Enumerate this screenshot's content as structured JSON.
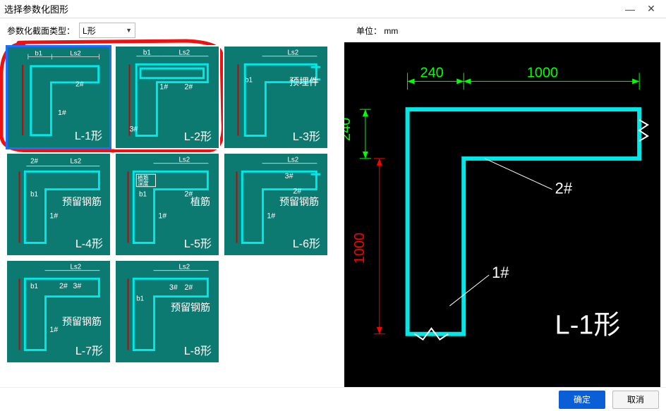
{
  "title": "选择参数化图形",
  "window": {
    "minimize": "—",
    "close": "✕"
  },
  "typeLabel": "参数化截面类型：",
  "typeValue": "L形",
  "unitLabel": "单位：",
  "unitValue": "mm",
  "thumbs": [
    {
      "name": "L-1形",
      "dims": {
        "b1": "b1",
        "ls2": "Ls2",
        "tag1": "1#",
        "tag2": "2#"
      }
    },
    {
      "name": "L-2形",
      "dims": {
        "b1": "b1",
        "ls2": "Ls2",
        "tag1": "1#",
        "tag2": "2#",
        "tag3": "3#"
      }
    },
    {
      "name": "L-3形",
      "dims": {
        "b1": "b1",
        "ls2": "Ls2",
        "extra": "预埋件"
      }
    },
    {
      "name": "L-4形",
      "dims": {
        "b1": "b1",
        "ls2": "Ls2",
        "tag1": "1#",
        "tag2": "2#",
        "extra": "预留钢筋"
      }
    },
    {
      "name": "L-5形",
      "dims": {
        "b1": "b1",
        "ls2": "Ls2",
        "tag1": "1#",
        "tag2": "2#",
        "extra": "植筋",
        "extra2": "植筋\n深度"
      }
    },
    {
      "name": "L-6形",
      "dims": {
        "b1": "b1",
        "ls2": "Ls2",
        "tag1": "1#",
        "tag2": "2#",
        "tag3": "3#",
        "extra": "预留钢筋"
      }
    },
    {
      "name": "L-7形",
      "dims": {
        "b1": "b1",
        "ls2": "Ls2",
        "tag1": "1#",
        "tag2": "2#",
        "tag3": "3#",
        "extra": "预留钢筋"
      }
    },
    {
      "name": "L-8形",
      "dims": {
        "b1": "b1",
        "ls2": "Ls2",
        "tag2": "2#",
        "tag3": "3#",
        "extra": "预留钢筋"
      }
    }
  ],
  "preview": {
    "name": "L-1形",
    "dimA": "240",
    "dimB": "1000",
    "dimC": "240",
    "dimD": "1000",
    "tag1": "1#",
    "tag2": "2#"
  },
  "buttons": {
    "ok": "确定",
    "cancel": "取消"
  }
}
